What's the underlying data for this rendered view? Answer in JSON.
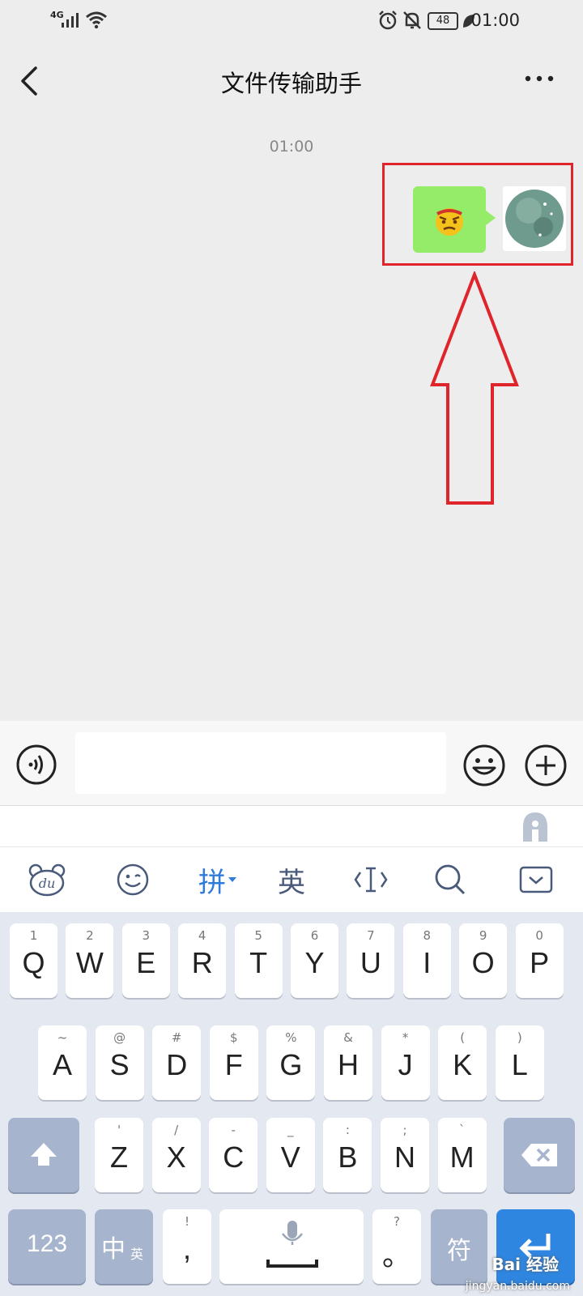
{
  "status_bar": {
    "network": "4G",
    "battery": "48",
    "time": "01:00"
  },
  "nav": {
    "title": "文件传输助手"
  },
  "chat": {
    "timestamp": "01:00"
  },
  "input": {
    "value": "",
    "placeholder": ""
  },
  "toolbar": {
    "pinyin": "拼",
    "english": "英"
  },
  "keyboard": {
    "row1": [
      {
        "hint": "1",
        "key": "Q"
      },
      {
        "hint": "2",
        "key": "W"
      },
      {
        "hint": "3",
        "key": "E"
      },
      {
        "hint": "4",
        "key": "R"
      },
      {
        "hint": "5",
        "key": "T"
      },
      {
        "hint": "6",
        "key": "Y"
      },
      {
        "hint": "7",
        "key": "U"
      },
      {
        "hint": "8",
        "key": "I"
      },
      {
        "hint": "9",
        "key": "O"
      },
      {
        "hint": "0",
        "key": "P"
      }
    ],
    "row2": [
      {
        "hint": "~",
        "key": "A"
      },
      {
        "hint": "@",
        "key": "S"
      },
      {
        "hint": "#",
        "key": "D"
      },
      {
        "hint": "$",
        "key": "F"
      },
      {
        "hint": "%",
        "key": "G"
      },
      {
        "hint": "&",
        "key": "H"
      },
      {
        "hint": "*",
        "key": "J"
      },
      {
        "hint": "(",
        "key": "K"
      },
      {
        "hint": ")",
        "key": "L"
      }
    ],
    "row3": [
      {
        "hint": "'",
        "key": "Z"
      },
      {
        "hint": "/",
        "key": "X"
      },
      {
        "hint": "-",
        "key": "C"
      },
      {
        "hint": "_",
        "key": "V"
      },
      {
        "hint": ":",
        "key": "B"
      },
      {
        "hint": ";",
        "key": "N"
      },
      {
        "hint": "`",
        "key": "M"
      }
    ],
    "num_label": "123",
    "lang_label": "中",
    "lang_sub": "英",
    "comma_hint": "!",
    "comma_key": ",",
    "period_hint": "?",
    "period_key": "。",
    "symbol_label": "符"
  },
  "watermark": "Bai 经验",
  "watermark_url": "jingyan.baidu.com",
  "colors": {
    "bubble": "#95ec69",
    "highlight": "#e0242b",
    "accent": "#2f86e0"
  },
  "icons": [
    "signal-icon",
    "wifi-icon",
    "alarm-icon",
    "mute-bell-icon",
    "leaf-icon",
    "back-icon",
    "more-icon",
    "voice-icon",
    "emoji-icon",
    "plus-icon",
    "baidu-input-icon",
    "smiley-icon",
    "cursor-icon",
    "search-icon",
    "hide-keyboard-icon",
    "shift-icon",
    "delete-icon",
    "mic-icon",
    "enter-icon"
  ]
}
